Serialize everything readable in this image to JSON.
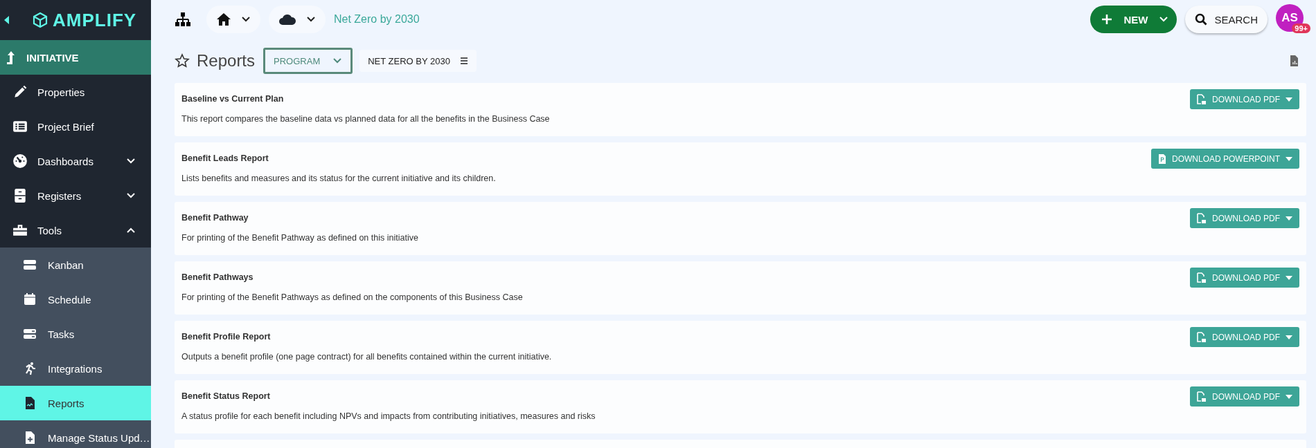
{
  "sidebar": {
    "logo": "AMPLIFY",
    "section": "INITIATIVE",
    "items": [
      {
        "label": "Properties"
      },
      {
        "label": "Project Brief"
      },
      {
        "label": "Dashboards",
        "expanded": false
      },
      {
        "label": "Registers",
        "expanded": false
      },
      {
        "label": "Tools",
        "expanded": true,
        "children": [
          {
            "label": "Kanban",
            "selected": false
          },
          {
            "label": "Schedule",
            "selected": false
          },
          {
            "label": "Tasks",
            "selected": false
          },
          {
            "label": "Integrations",
            "selected": false
          },
          {
            "label": "Reports",
            "selected": true
          },
          {
            "label": "Manage Status Upd…",
            "selected": false
          }
        ]
      }
    ]
  },
  "top_bar": {
    "breadcrumb": "Net Zero by 2030",
    "new_button": "NEW",
    "search_button": "SEARCH",
    "avatar": "AS",
    "notification_badge": "99+"
  },
  "page": {
    "title": "Reports",
    "scope_dropdown": "PROGRAM",
    "context_chip": "NET ZERO BY 2030"
  },
  "reports": [
    {
      "title": "Baseline vs Current Plan",
      "description": "This report compares the baseline data vs planned data for all the benefits in the Business Case",
      "button": "DOWNLOAD PDF",
      "kind": "pdf"
    },
    {
      "title": "Benefit Leads Report",
      "description": "Lists benefits and measures and its status for the current initiative and its children.",
      "button": "DOWNLOAD POWERPOINT",
      "kind": "powerpoint"
    },
    {
      "title": "Benefit Pathway",
      "description": "For printing of the Benefit Pathway as defined on this initiative",
      "button": "DOWNLOAD PDF",
      "kind": "pdf"
    },
    {
      "title": "Benefit Pathways",
      "description": "For printing of the Benefit Pathways as defined on the components of this Business Case",
      "button": "DOWNLOAD PDF",
      "kind": "pdf"
    },
    {
      "title": "Benefit Profile Report",
      "description": "Outputs a benefit profile (one page contract) for all benefits contained within the current initiative.",
      "button": "DOWNLOAD PDF",
      "kind": "pdf"
    },
    {
      "title": "Benefit Status Report",
      "description": "A status profile for each benefit including NPVs and impacts from contributing initiatives, measures and risks",
      "button": "DOWNLOAD PDF",
      "kind": "pdf"
    }
  ]
}
